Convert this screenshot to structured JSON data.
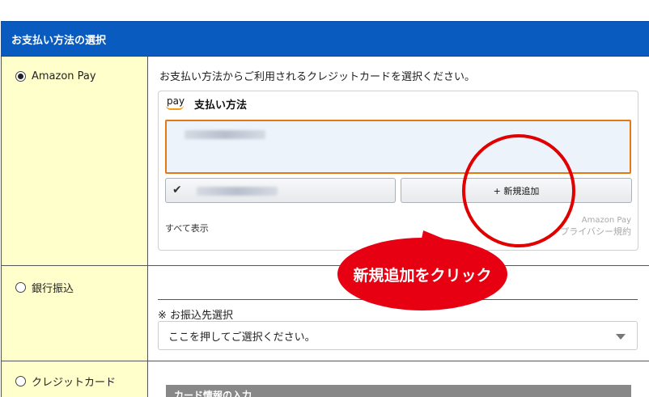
{
  "header": {
    "title": "お支払い方法の選択"
  },
  "options": {
    "amazon": {
      "label": "Amazon Pay",
      "selected": true,
      "instruction": "お支払い方法からご利用されるクレジットカードを選択ください。",
      "widget": {
        "logo": "pay",
        "title": "支払い方法",
        "add_new_label": "+ 新規追加",
        "show_all": "すべて表示",
        "brand": "Amazon Pay",
        "privacy": "プライバシー規約"
      }
    },
    "bank": {
      "label": "銀行振込",
      "selected": false,
      "sub_label": "※ お振込先選択",
      "select_placeholder": "ここを押してご選択ください。"
    },
    "credit": {
      "label": "クレジットカード",
      "selected": false,
      "card_header": "カード情報の入力"
    }
  },
  "annotation": {
    "callout_text": "新規追加をクリック",
    "accent_color": "#e60012"
  }
}
